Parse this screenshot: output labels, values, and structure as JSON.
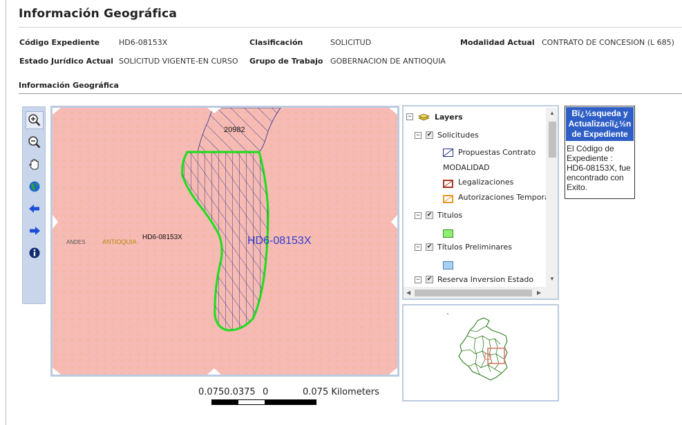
{
  "header": {
    "title": "Información Geográfica"
  },
  "fields": {
    "codigo_label": "Código Expediente",
    "codigo_value": "HD6-08153X",
    "clasificacion_label": "Clasificación",
    "clasificacion_value": "SOLICITUD",
    "modalidad_label": "Modalidad Actual",
    "modalidad_value": "CONTRATO DE CONCESION (L 685)",
    "estado_label": "Estado Jurídico Actual",
    "estado_value": "SOLICITUD VIGENTE-EN CURSO",
    "grupo_label": "Grupo de Trabajo",
    "grupo_value": "GOBERNACION DE ANTIOQUIA"
  },
  "section": {
    "title": "Información Geográfica"
  },
  "toolbar": {
    "tools": [
      "zoom-in-icon",
      "zoom-out-icon",
      "pan-hand-icon",
      "full-extent-globe-icon",
      "previous-extent-icon",
      "next-extent-icon",
      "identify-info-icon"
    ]
  },
  "map": {
    "label_20982": "20982",
    "label_andes": "ANDES",
    "label_antioquia": "ANTIOQUIA",
    "label_expediente_small": "HD6-08153X",
    "label_expediente_large": "HD6-08153X",
    "colors": {
      "background": "#f6bbb5",
      "dot": "#e6a12a",
      "polygon_outline": "#22dd22",
      "hatch": "#1f2d8a",
      "label_large": "#2f3fd0",
      "label_antioquia": "#b8860b"
    }
  },
  "scalebar": {
    "left_label": "0.0750.0375",
    "zero_label": "0",
    "right_label": "0.075 Kilometers"
  },
  "layers": {
    "root": "Layers",
    "solicitudes": "Solicitudes",
    "propuestas": "Propuestas Contrato",
    "modalidad": "MODALIDAD",
    "legalizaciones": "Legalizaciones",
    "autorizaciones": "Autorizaciones Temporales",
    "titulos": "Titulos",
    "titulos_preliminares": "Títulos Preliminares",
    "reserva": "Reserva Inversion Estado",
    "colors": {
      "legalizaciones": "#a0391b",
      "autorizaciones": "#e89a26",
      "titulos": "#90ee70",
      "titulos_preliminares": "#a8d0f0"
    }
  },
  "search": {
    "header": "Bï¿½squeda y Actualizaciï¿½n de Expediente",
    "message": "El Código de Expediente : HD6-08153X, fue encontrado con Exito."
  }
}
